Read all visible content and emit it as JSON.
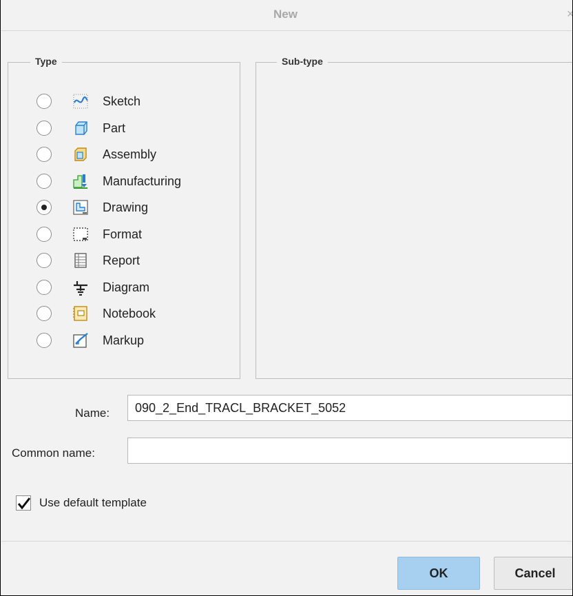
{
  "window": {
    "title": "New",
    "close_glyph": "×"
  },
  "type_group": {
    "legend": "Type",
    "items": [
      {
        "label": "Sketch",
        "icon": "sketch-icon",
        "selected": false
      },
      {
        "label": "Part",
        "icon": "part-icon",
        "selected": false
      },
      {
        "label": "Assembly",
        "icon": "assembly-icon",
        "selected": false
      },
      {
        "label": "Manufacturing",
        "icon": "manufacturing-icon",
        "selected": false
      },
      {
        "label": "Drawing",
        "icon": "drawing-icon",
        "selected": true
      },
      {
        "label": "Format",
        "icon": "format-icon",
        "selected": false
      },
      {
        "label": "Report",
        "icon": "report-icon",
        "selected": false
      },
      {
        "label": "Diagram",
        "icon": "diagram-icon",
        "selected": false
      },
      {
        "label": "Notebook",
        "icon": "notebook-icon",
        "selected": false
      },
      {
        "label": "Markup",
        "icon": "markup-icon",
        "selected": false
      }
    ]
  },
  "subtype_group": {
    "legend": "Sub-type"
  },
  "fields": {
    "name_label": "Name:",
    "name_value": "090_2_End_TRACL_BRACKET_5052",
    "common_name_label": "Common name:",
    "common_name_value": ""
  },
  "template": {
    "label": "Use default template",
    "checked": true
  },
  "buttons": {
    "ok_label": "OK",
    "cancel_label": "Cancel"
  },
  "colors": {
    "ok_button_bg": "#a6cff0",
    "dialog_bg": "#f2f2f2"
  }
}
